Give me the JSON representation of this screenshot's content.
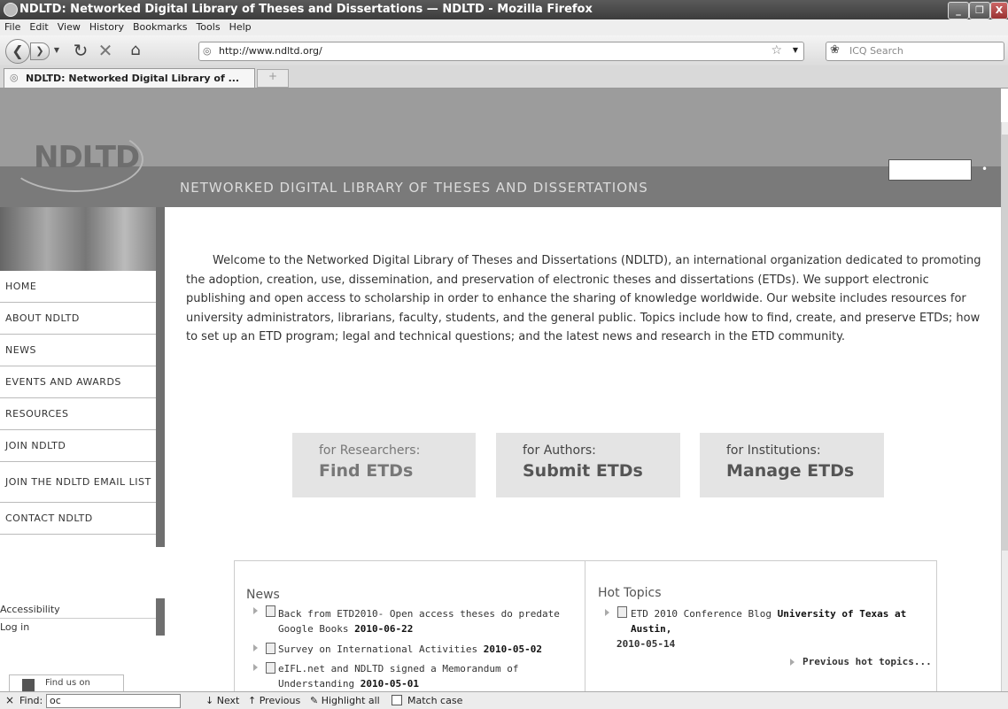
{
  "window": {
    "title": "NDLTD: Networked Digital Library of Theses and Dissertations — NDLTD - Mozilla Firefox",
    "min": "_",
    "restore": "❐",
    "close": "X"
  },
  "menu": [
    "File",
    "Edit",
    "View",
    "History",
    "Bookmarks",
    "Tools",
    "Help"
  ],
  "nav": {
    "url": "http://www.ndltd.org/",
    "search_placeholder": "ICQ Search"
  },
  "tab": {
    "label": "NDLTD: Networked Digital Library of ...",
    "new_tab": "+"
  },
  "header": {
    "logo": "NDLTD",
    "title": "NETWORKED DIGITAL LIBRARY OF THESES AND DISSERTATIONS"
  },
  "sidebar": {
    "items": [
      "HOME",
      "ABOUT NDLTD",
      "NEWS",
      "EVENTS AND AWARDS",
      "RESOURCES",
      "JOIN NDLTD",
      "JOIN THE NDLTD EMAIL LIST",
      "CONTACT NDLTD"
    ],
    "accessibility": "Accessibility",
    "login": "Log in",
    "find_us": "Find us on"
  },
  "welcome": "Welcome to the Networked Digital Library of Theses and Dissertations (NDLTD), an international organization dedicated to promoting the adoption, creation, use, dissemination, and preservation of electronic theses and dissertations (ETDs). We support electronic publishing and open access to scholarship in order to enhance the sharing of knowledge worldwide. Our website includes resources for university administrators, librarians, faculty, students, and the general public. Topics include how to find, create, and preserve ETDs; how to set up an ETD program; legal and technical questions; and the latest news and research in the ETD community.",
  "cta": [
    {
      "sub": "for Researchers:",
      "main": "Find ETDs"
    },
    {
      "sub": "for Authors:",
      "main": "Submit ETDs"
    },
    {
      "sub": "for Institutions:",
      "main": "Manage ETDs"
    }
  ],
  "news": {
    "heading": "News",
    "items": [
      {
        "text": "Back from ETD2010- Open access theses do predate Google Books",
        "date": "2010-06-22"
      },
      {
        "text": "Survey on International Activities",
        "date": "2010-05-02"
      },
      {
        "text": "eIFL.net and NDLTD signed a Memorandum of Understanding",
        "date": "2010-05-01"
      }
    ]
  },
  "hot": {
    "heading": "Hot Topics",
    "item_text": "ETD 2010 Conference Blog",
    "item_bold": "University of Texas at Austin,",
    "item_date": "2010-05-14",
    "previous": "Previous hot topics..."
  },
  "findbar": {
    "close": "×",
    "label": "Find:",
    "value": "oc",
    "next": "Next",
    "previous": "Previous",
    "highlight": "Highlight all",
    "match": "Match case"
  }
}
